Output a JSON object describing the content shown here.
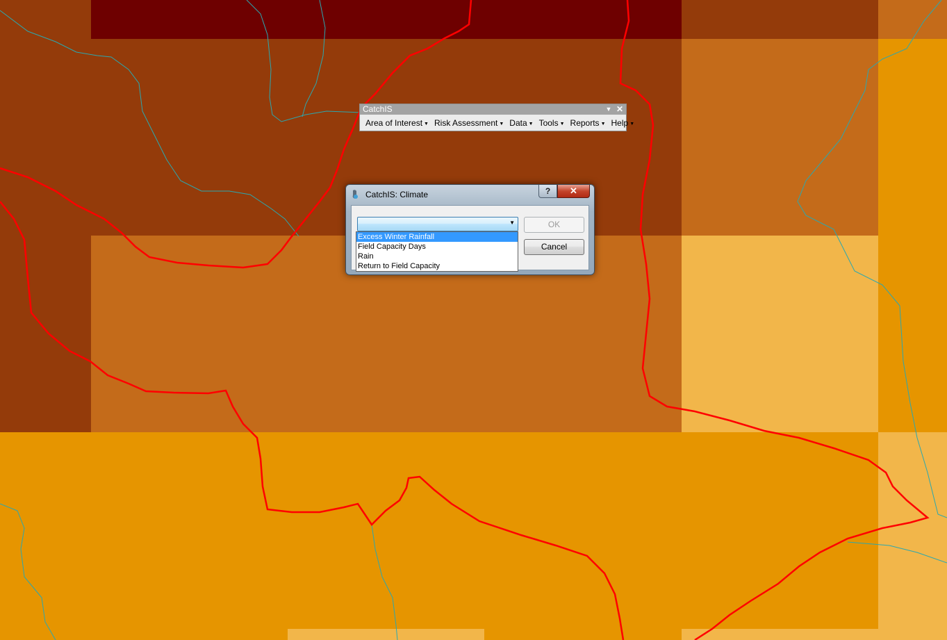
{
  "toolbar": {
    "title": "CatchIS",
    "menu": [
      "Area of Interest",
      "Risk Assessment",
      "Data",
      "Tools",
      "Reports",
      "Help"
    ]
  },
  "dialog": {
    "title": "CatchIS: Climate",
    "help_label": "?",
    "close_label": "✕",
    "ok_label": "OK",
    "cancel_label": "Cancel",
    "ok_enabled": false
  },
  "dropdown": {
    "options": [
      "Excess Winter Rainfall",
      "Field Capacity Days",
      "Rain",
      "Return to Field Capacity"
    ],
    "highlighted": "Excess Winter Rainfall"
  },
  "map": {
    "colors": {
      "darkest": "#6e0000",
      "dark": "#943b0a",
      "mid": "#c46b1a",
      "base": "#e69500",
      "light": "#f2b64a",
      "boundary": "#ff0000",
      "river": "#2aa8b0"
    }
  }
}
